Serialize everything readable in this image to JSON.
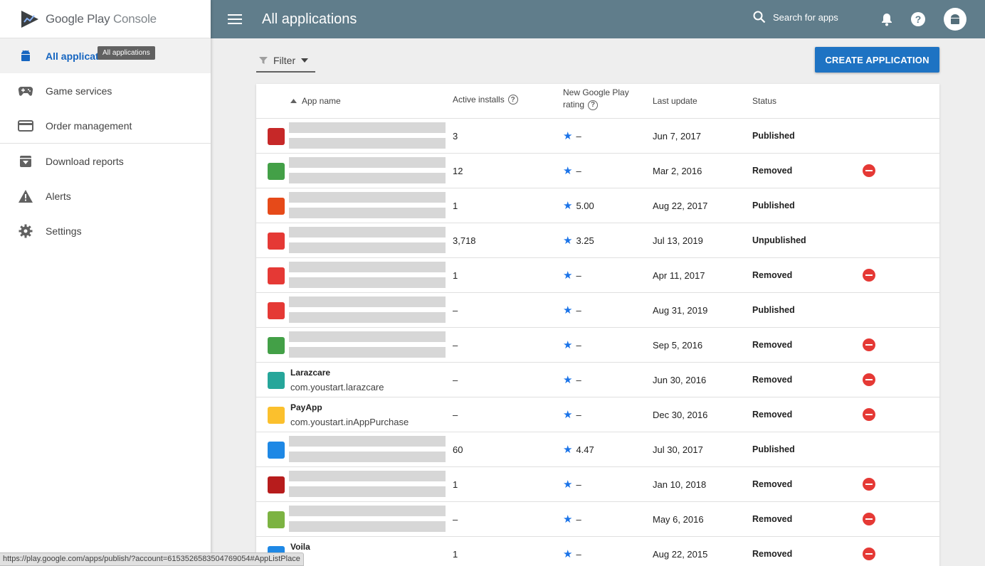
{
  "brand": {
    "name_main": "Google Play",
    "name_light": "Console"
  },
  "sidebar": {
    "items": [
      {
        "label": "All applications",
        "icon": "android-icon",
        "active": true
      },
      {
        "label": "Game services",
        "icon": "gamepad-icon"
      },
      {
        "label": "Order management",
        "icon": "credit-card-icon"
      },
      {
        "label": "Download reports",
        "icon": "archive-download-icon"
      },
      {
        "label": "Alerts",
        "icon": "warning-icon"
      },
      {
        "label": "Settings",
        "icon": "gear-icon"
      }
    ],
    "tooltip": "All applications",
    "active_label_visible": "All applicati"
  },
  "header": {
    "title": "All applications",
    "search_placeholder": "Search for apps",
    "bg_color": "#607d8b"
  },
  "toolbar": {
    "filter_label": "Filter",
    "create_label": "CREATE APPLICATION",
    "create_color": "#1e73c3"
  },
  "table": {
    "headers": {
      "app_name": "App name",
      "installs": "Active installs",
      "rating_line1": "New Google Play",
      "rating_line2": "rating",
      "updated": "Last update",
      "status": "Status"
    },
    "rows": [
      {
        "name": "",
        "pkg": "",
        "installs": "3",
        "rating": "–",
        "updated": "Jun 7, 2017",
        "status": "Published",
        "removed": false,
        "icon_color": "#c62828",
        "icon": "red-square-icon"
      },
      {
        "name": "",
        "pkg": "",
        "installs": "12",
        "rating": "–",
        "updated": "Mar 2, 2016",
        "status": "Removed",
        "removed": true,
        "icon_color": "#43a047",
        "icon": "green-pk-icon"
      },
      {
        "name": "",
        "pkg": "",
        "installs": "1",
        "rating": "5.00",
        "updated": "Aug 22, 2017",
        "status": "Published",
        "removed": false,
        "icon_color": "#e64a19",
        "icon": "dc-icon"
      },
      {
        "name": "",
        "pkg": "",
        "installs": "3,718",
        "rating": "3.25",
        "updated": "Jul 13, 2019",
        "status": "Unpublished",
        "removed": false,
        "icon_color": "#e53935",
        "icon": "rocket-icon"
      },
      {
        "name": "",
        "pkg": "",
        "installs": "1",
        "rating": "–",
        "updated": "Apr 11, 2017",
        "status": "Removed",
        "removed": true,
        "icon_color": "#e53935",
        "icon": "bird-icon"
      },
      {
        "name": "",
        "pkg": "",
        "installs": "–",
        "rating": "–",
        "updated": "Aug 31, 2019",
        "status": "Published",
        "removed": false,
        "icon_color": "#e53935",
        "icon": "g-logo-icon"
      },
      {
        "name": "",
        "pkg": "",
        "installs": "–",
        "rating": "–",
        "updated": "Sep 5, 2016",
        "status": "Removed",
        "removed": true,
        "icon_color": "#43a047",
        "icon": "runner-icon"
      },
      {
        "name": "Larazcare",
        "pkg": "com.youstart.larazcare",
        "installs": "–",
        "rating": "–",
        "updated": "Jun 30, 2016",
        "status": "Removed",
        "removed": true,
        "icon_color": "#26a69a",
        "icon": "larazcare-icon"
      },
      {
        "name": "PayApp",
        "pkg": "com.youstart.inAppPurchase",
        "installs": "–",
        "rating": "–",
        "updated": "Dec 30, 2016",
        "status": "Removed",
        "removed": true,
        "icon_color": "#fbc02d",
        "icon": "batman-icon"
      },
      {
        "name": "",
        "pkg": "",
        "installs": "60",
        "rating": "4.47",
        "updated": "Jul 30, 2017",
        "status": "Published",
        "removed": false,
        "icon_color": "#1e88e5",
        "icon": "q-logo-icon"
      },
      {
        "name": "",
        "pkg": "",
        "installs": "1",
        "rating": "–",
        "updated": "Jan 10, 2018",
        "status": "Removed",
        "removed": true,
        "icon_color": "#b71c1c",
        "icon": "book-icon"
      },
      {
        "name": "",
        "pkg": "",
        "installs": "–",
        "rating": "–",
        "updated": "May 6, 2016",
        "status": "Removed",
        "removed": true,
        "icon_color": "#7cb342",
        "icon": "coin-icon"
      },
      {
        "name": "Voila",
        "pkg": "",
        "installs": "1",
        "rating": "–",
        "updated": "Aug 22, 2015",
        "status": "Removed",
        "removed": true,
        "icon_color": "#1e88e5",
        "icon": "voila-icon"
      }
    ]
  },
  "status_url": "https://play.google.com/apps/publish/?account=6153526583504769054#AppListPlace"
}
